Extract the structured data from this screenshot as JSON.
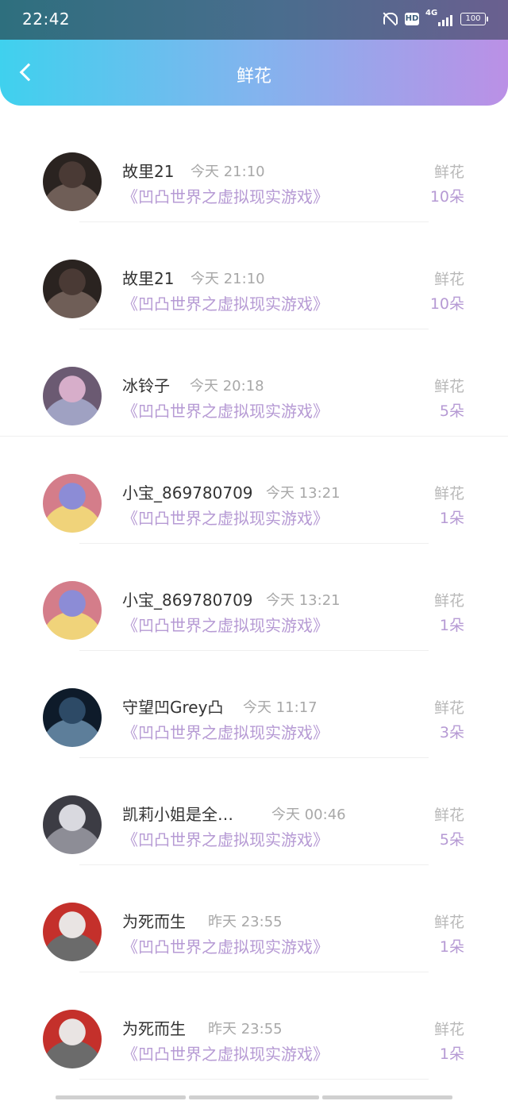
{
  "status": {
    "time": "22:42",
    "network": "4G",
    "battery": "100",
    "hd": "HD"
  },
  "header": {
    "title": "鲜花"
  },
  "gift_label": "鲜花",
  "rows": [
    {
      "name": "故里21",
      "time": "今天 21:10",
      "book": "《凹凸世界之虚拟现实游戏》",
      "count": "10朵",
      "avatar_colors": [
        "#2a2320",
        "#4a3a35",
        "#6f5e57"
      ]
    },
    {
      "name": "故里21",
      "time": "今天 21:10",
      "book": "《凹凸世界之虚拟现实游戏》",
      "count": "10朵",
      "avatar_colors": [
        "#2a2320",
        "#4a3a35",
        "#6f5e57"
      ]
    },
    {
      "name": "冰铃子",
      "time": "今天 20:18",
      "book": "《凹凸世界之虚拟现实游戏》",
      "count": "5朵",
      "avatar_colors": [
        "#6b5a72",
        "#d7aeca",
        "#9fa1c2"
      ]
    },
    {
      "name": "小宝_869780709",
      "time": "今天 13:21",
      "book": "《凹凸世界之虚拟现实游戏》",
      "count": "1朵",
      "avatar_colors": [
        "#d47d8a",
        "#8c8cd6",
        "#f0d37a"
      ]
    },
    {
      "name": "小宝_869780709",
      "time": "今天 13:21",
      "book": "《凹凸世界之虚拟现实游戏》",
      "count": "1朵",
      "avatar_colors": [
        "#d47d8a",
        "#8c8cd6",
        "#f0d37a"
      ]
    },
    {
      "name": "守望凹Grey凸",
      "time": "今天 11:17",
      "book": "《凹凸世界之虚拟现实游戏》",
      "count": "3朵",
      "avatar_colors": [
        "#0e1b2a",
        "#2d4a66",
        "#5d7e9a"
      ]
    },
    {
      "name": "凯莉小姐是全…",
      "time": "今天 00:46",
      "book": "《凹凸世界之虚拟现实游戏》",
      "count": "5朵",
      "avatar_colors": [
        "#3c3c44",
        "#d9d9df",
        "#8d8d96"
      ]
    },
    {
      "name": "为死而生",
      "time": "昨天 23:55",
      "book": "《凹凸世界之虚拟现实游戏》",
      "count": "1朵",
      "avatar_colors": [
        "#c4302b",
        "#e9e4e3",
        "#6b6b6b"
      ]
    },
    {
      "name": "为死而生",
      "time": "昨天 23:55",
      "book": "《凹凸世界之虚拟现实游戏》",
      "count": "1朵",
      "avatar_colors": [
        "#c4302b",
        "#e9e4e3",
        "#6b6b6b"
      ]
    }
  ]
}
